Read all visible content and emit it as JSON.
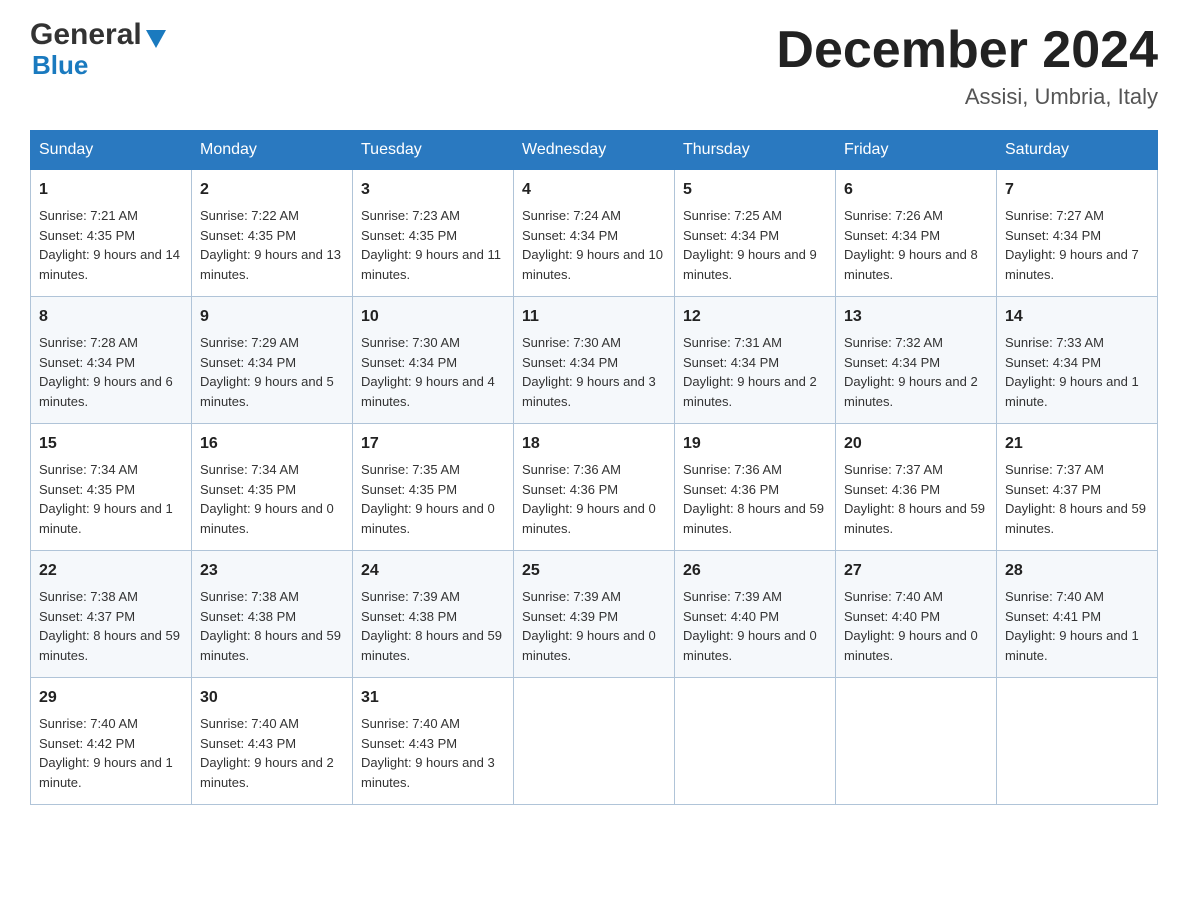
{
  "header": {
    "logo_general": "General",
    "logo_blue": "Blue",
    "month_title": "December 2024",
    "location": "Assisi, Umbria, Italy"
  },
  "days_of_week": [
    "Sunday",
    "Monday",
    "Tuesday",
    "Wednesday",
    "Thursday",
    "Friday",
    "Saturday"
  ],
  "weeks": [
    [
      {
        "day": "1",
        "sunrise": "7:21 AM",
        "sunset": "4:35 PM",
        "daylight": "9 hours and 14 minutes."
      },
      {
        "day": "2",
        "sunrise": "7:22 AM",
        "sunset": "4:35 PM",
        "daylight": "9 hours and 13 minutes."
      },
      {
        "day": "3",
        "sunrise": "7:23 AM",
        "sunset": "4:35 PM",
        "daylight": "9 hours and 11 minutes."
      },
      {
        "day": "4",
        "sunrise": "7:24 AM",
        "sunset": "4:34 PM",
        "daylight": "9 hours and 10 minutes."
      },
      {
        "day": "5",
        "sunrise": "7:25 AM",
        "sunset": "4:34 PM",
        "daylight": "9 hours and 9 minutes."
      },
      {
        "day": "6",
        "sunrise": "7:26 AM",
        "sunset": "4:34 PM",
        "daylight": "9 hours and 8 minutes."
      },
      {
        "day": "7",
        "sunrise": "7:27 AM",
        "sunset": "4:34 PM",
        "daylight": "9 hours and 7 minutes."
      }
    ],
    [
      {
        "day": "8",
        "sunrise": "7:28 AM",
        "sunset": "4:34 PM",
        "daylight": "9 hours and 6 minutes."
      },
      {
        "day": "9",
        "sunrise": "7:29 AM",
        "sunset": "4:34 PM",
        "daylight": "9 hours and 5 minutes."
      },
      {
        "day": "10",
        "sunrise": "7:30 AM",
        "sunset": "4:34 PM",
        "daylight": "9 hours and 4 minutes."
      },
      {
        "day": "11",
        "sunrise": "7:30 AM",
        "sunset": "4:34 PM",
        "daylight": "9 hours and 3 minutes."
      },
      {
        "day": "12",
        "sunrise": "7:31 AM",
        "sunset": "4:34 PM",
        "daylight": "9 hours and 2 minutes."
      },
      {
        "day": "13",
        "sunrise": "7:32 AM",
        "sunset": "4:34 PM",
        "daylight": "9 hours and 2 minutes."
      },
      {
        "day": "14",
        "sunrise": "7:33 AM",
        "sunset": "4:34 PM",
        "daylight": "9 hours and 1 minute."
      }
    ],
    [
      {
        "day": "15",
        "sunrise": "7:34 AM",
        "sunset": "4:35 PM",
        "daylight": "9 hours and 1 minute."
      },
      {
        "day": "16",
        "sunrise": "7:34 AM",
        "sunset": "4:35 PM",
        "daylight": "9 hours and 0 minutes."
      },
      {
        "day": "17",
        "sunrise": "7:35 AM",
        "sunset": "4:35 PM",
        "daylight": "9 hours and 0 minutes."
      },
      {
        "day": "18",
        "sunrise": "7:36 AM",
        "sunset": "4:36 PM",
        "daylight": "9 hours and 0 minutes."
      },
      {
        "day": "19",
        "sunrise": "7:36 AM",
        "sunset": "4:36 PM",
        "daylight": "8 hours and 59 minutes."
      },
      {
        "day": "20",
        "sunrise": "7:37 AM",
        "sunset": "4:36 PM",
        "daylight": "8 hours and 59 minutes."
      },
      {
        "day": "21",
        "sunrise": "7:37 AM",
        "sunset": "4:37 PM",
        "daylight": "8 hours and 59 minutes."
      }
    ],
    [
      {
        "day": "22",
        "sunrise": "7:38 AM",
        "sunset": "4:37 PM",
        "daylight": "8 hours and 59 minutes."
      },
      {
        "day": "23",
        "sunrise": "7:38 AM",
        "sunset": "4:38 PM",
        "daylight": "8 hours and 59 minutes."
      },
      {
        "day": "24",
        "sunrise": "7:39 AM",
        "sunset": "4:38 PM",
        "daylight": "8 hours and 59 minutes."
      },
      {
        "day": "25",
        "sunrise": "7:39 AM",
        "sunset": "4:39 PM",
        "daylight": "9 hours and 0 minutes."
      },
      {
        "day": "26",
        "sunrise": "7:39 AM",
        "sunset": "4:40 PM",
        "daylight": "9 hours and 0 minutes."
      },
      {
        "day": "27",
        "sunrise": "7:40 AM",
        "sunset": "4:40 PM",
        "daylight": "9 hours and 0 minutes."
      },
      {
        "day": "28",
        "sunrise": "7:40 AM",
        "sunset": "4:41 PM",
        "daylight": "9 hours and 1 minute."
      }
    ],
    [
      {
        "day": "29",
        "sunrise": "7:40 AM",
        "sunset": "4:42 PM",
        "daylight": "9 hours and 1 minute."
      },
      {
        "day": "30",
        "sunrise": "7:40 AM",
        "sunset": "4:43 PM",
        "daylight": "9 hours and 2 minutes."
      },
      {
        "day": "31",
        "sunrise": "7:40 AM",
        "sunset": "4:43 PM",
        "daylight": "9 hours and 3 minutes."
      },
      null,
      null,
      null,
      null
    ]
  ],
  "labels": {
    "sunrise": "Sunrise:",
    "sunset": "Sunset:",
    "daylight": "Daylight:"
  }
}
